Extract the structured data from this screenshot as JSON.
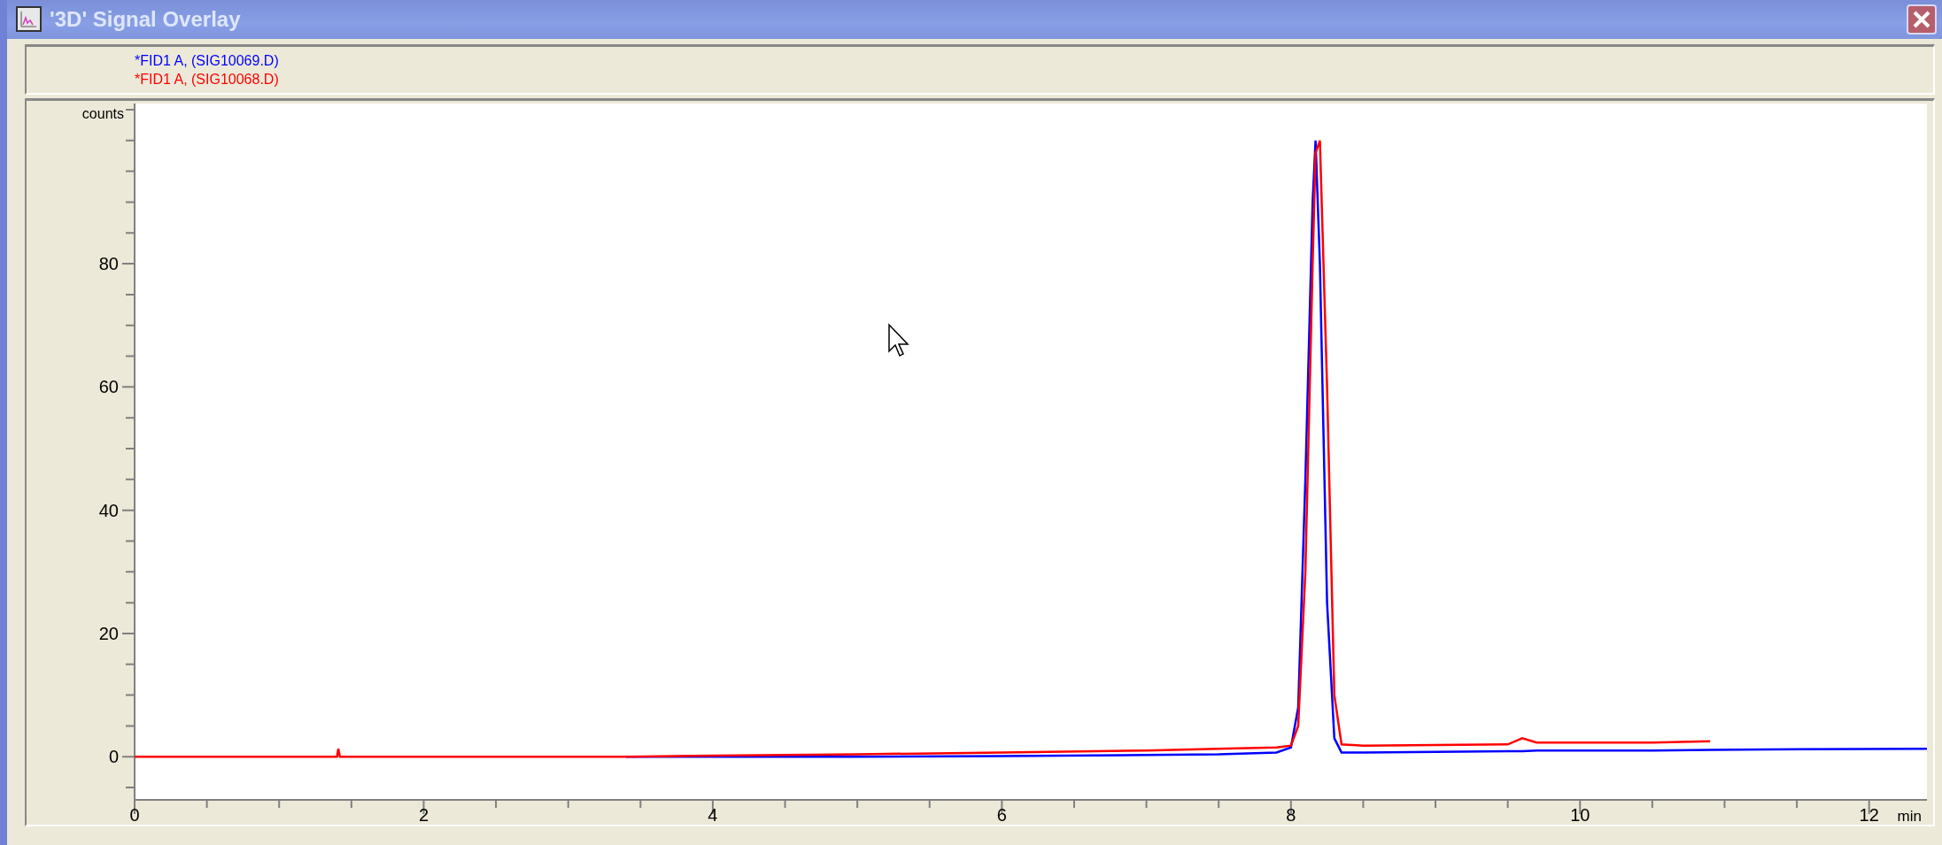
{
  "window": {
    "title": "'3D' Signal Overlay"
  },
  "chart_data": {
    "type": "line",
    "xlabel": "min",
    "ylabel": "counts",
    "xlim": [
      0,
      12.4
    ],
    "ylim": [
      -7,
      106
    ],
    "xticks": [
      0,
      2,
      4,
      6,
      8,
      10,
      12
    ],
    "yticks": [
      0,
      20,
      40,
      60,
      80
    ],
    "x": [
      0,
      1.4,
      1.41,
      1.42,
      3.4,
      4,
      5,
      6,
      7,
      7.5,
      7.9,
      8.0,
      8.05,
      8.1,
      8.15,
      8.17,
      8.2,
      8.25,
      8.3,
      8.35,
      8.5,
      9.5,
      9.6,
      9.7,
      10.5,
      10.9,
      11.3,
      12.4
    ],
    "series": [
      {
        "name": "*FID1 A, (SIG10069.D)",
        "color": "#0000ff",
        "values": [
          null,
          null,
          null,
          null,
          0,
          0,
          0,
          0.1,
          0.3,
          0.4,
          0.7,
          1.5,
          8,
          45,
          90,
          100,
          80,
          25,
          3,
          0.7,
          0.7,
          0.9,
          0.9,
          1,
          1,
          1.1,
          1.2,
          1.3
        ]
      },
      {
        "name": "*FID1 A, (SIG10068.D)",
        "color": "#ff0000",
        "values": [
          0,
          0,
          1.3,
          0,
          0,
          0.2,
          0.4,
          0.7,
          1,
          1.3,
          1.5,
          1.8,
          5,
          30,
          80,
          98,
          100,
          60,
          10,
          2,
          1.8,
          2,
          3,
          2.3,
          2.3,
          2.5,
          null,
          null
        ]
      }
    ]
  }
}
